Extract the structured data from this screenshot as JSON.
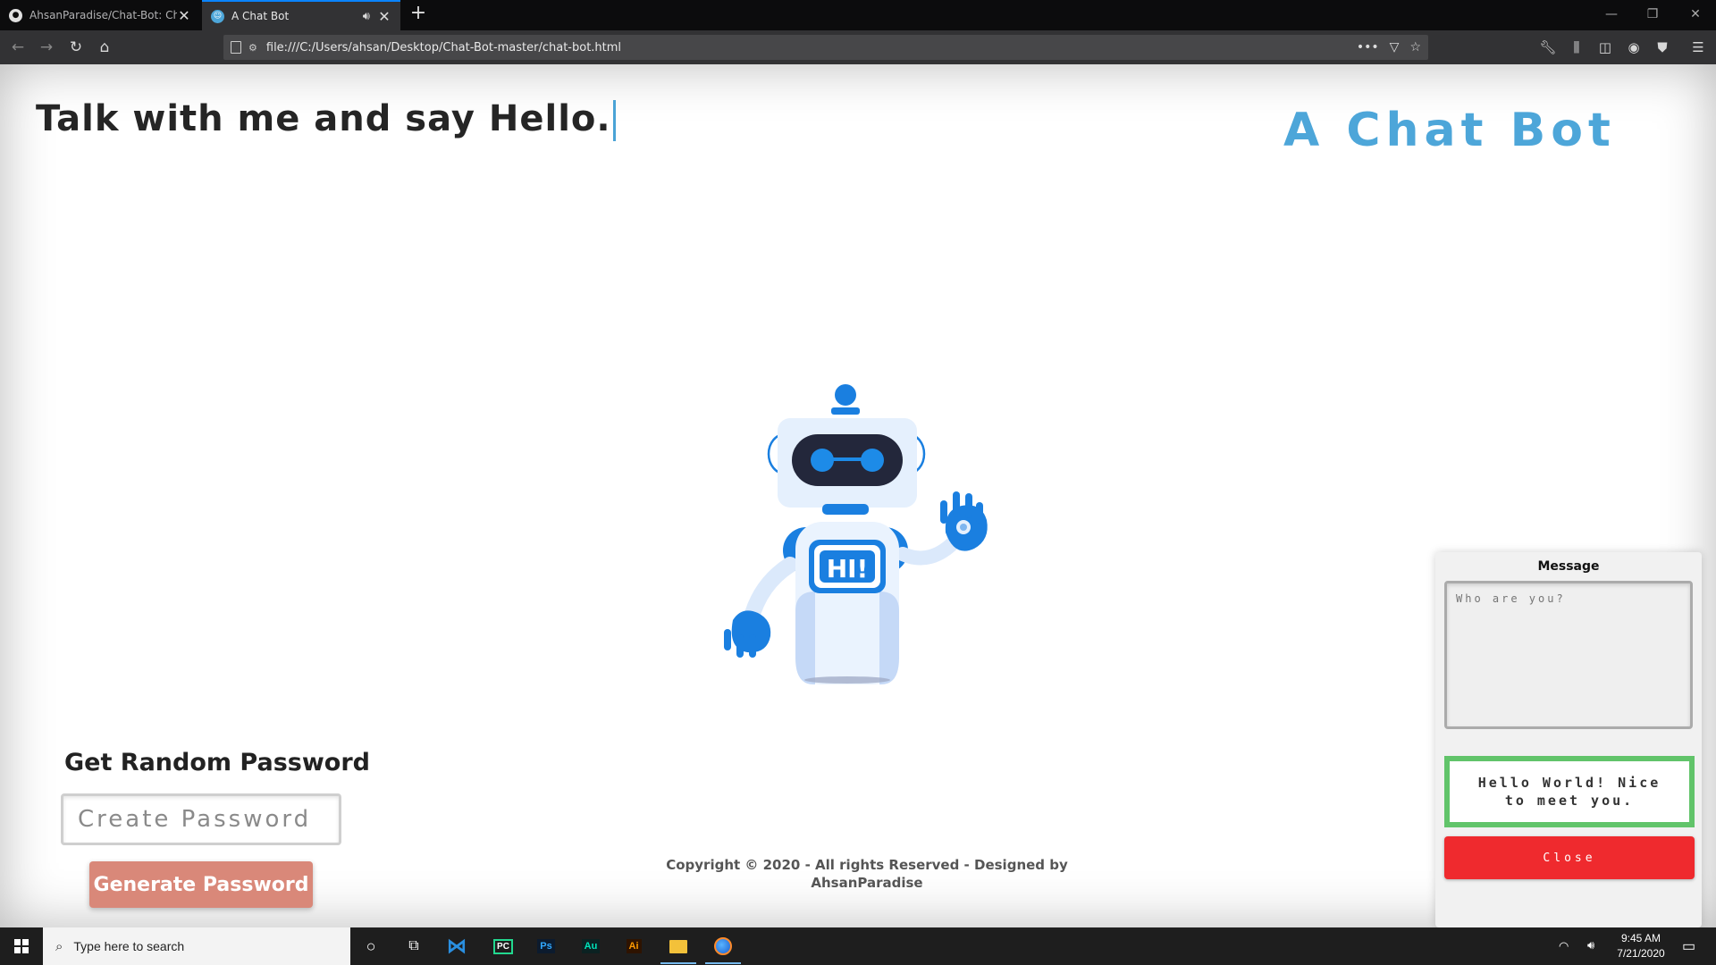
{
  "browser": {
    "tabs": [
      {
        "label": "AhsanParadise/Chat-Bot: Chat",
        "icon": "github-icon"
      },
      {
        "label": "A Chat Bot",
        "icon": "robot-icon",
        "audio": true
      }
    ],
    "url": "file:///C:/Users/ahsan/Desktop/Chat-Bot-master/chat-bot.html"
  },
  "page": {
    "typed_text": "Talk with me and say Hello.",
    "brand_title": "A Chat Bot",
    "robot_badge": "HI!",
    "password": {
      "title": "Get Random Password",
      "placeholder": "Create Password",
      "button_label": "Generate Password"
    },
    "copyright": "Copyright © 2020 - All rights Reserved - Designed by AhsanParadise",
    "message_panel": {
      "title": "Message",
      "input_placeholder": "Who are you?",
      "reply": "Hello World! Nice to meet you.",
      "close_label": "Close"
    },
    "colors": {
      "brand": "#4da6d9",
      "generate_button": "#d98879",
      "reply_border": "#61c46a",
      "close_button": "#ef2a2e"
    }
  },
  "taskbar": {
    "search_placeholder": "Type here to search",
    "apps": [
      "cortana",
      "task-view",
      "vscode",
      "pycharm",
      "photoshop",
      "audition",
      "illustrator",
      "file-explorer",
      "firefox"
    ],
    "time": "9:45 AM",
    "date": "7/21/2020"
  }
}
